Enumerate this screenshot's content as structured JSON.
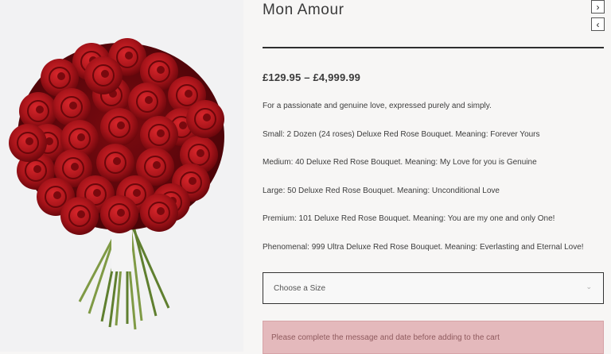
{
  "product": {
    "title": "Mon Amour",
    "price": "£129.95 – £4,999.99",
    "image_alt": "Bouquet of deluxe red roses"
  },
  "nav": {
    "next_symbol": "›",
    "prev_symbol": "‹"
  },
  "description": {
    "intro": "For a passionate and genuine love, expressed purely and simply.",
    "sizes": [
      "Small: 2 Dozen (24 roses) Deluxe Red Rose Bouquet. Meaning: Forever Yours",
      "Medium: 40 Deluxe Red Rose Bouquet. Meaning: My Love for you is Genuine",
      "Large: 50 Deluxe Red Rose Bouquet. Meaning: Unconditional Love",
      "Premium: 101 Deluxe Red Rose Bouquet. Meaning: You are my one and only One!",
      "Phenomenal: 999 Ultra Deluxe Red Rose Bouquet. Meaning: Everlasting and Eternal Love!"
    ]
  },
  "size_select": {
    "placeholder": "Choose a Size",
    "chevron": "⌄"
  },
  "alert": {
    "message": "Please complete the message and date before adding to the cart"
  },
  "colors": {
    "rose_red": "#b0151a",
    "alert_bg": "#e4b9bc",
    "stem_green": "#6f8f3a"
  }
}
